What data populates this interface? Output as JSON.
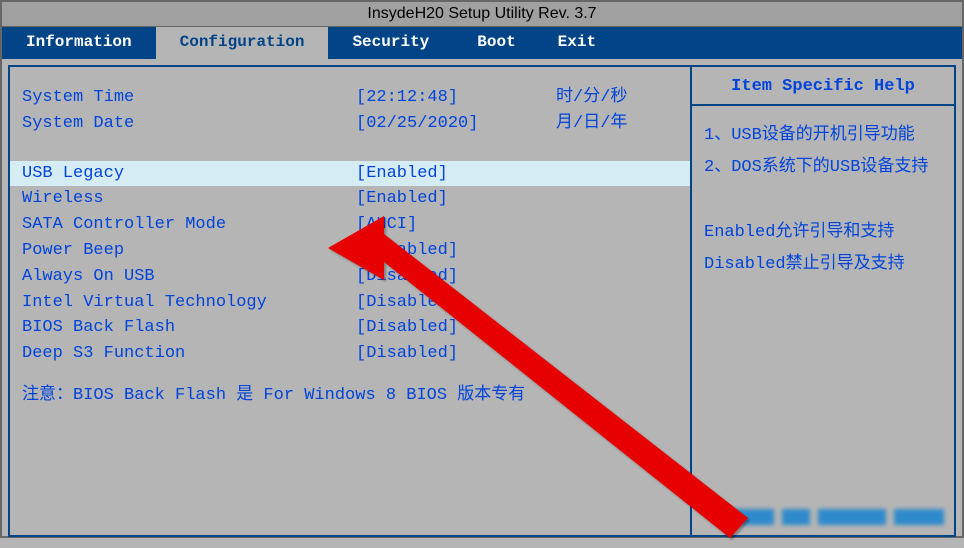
{
  "window": {
    "title": "InsydeH20 Setup Utility Rev. 3.7"
  },
  "tabs": {
    "information": "Information",
    "configuration": "Configuration",
    "security": "Security",
    "boot": "Boot",
    "exit": "Exit"
  },
  "settings": {
    "system_time": {
      "label": "System Time",
      "value": "[22:12:48]",
      "hint": "时/分/秒"
    },
    "system_date": {
      "label": "System Date",
      "value": "[02/25/2020]",
      "hint": "月/日/年"
    },
    "usb_legacy": {
      "label": "USB Legacy",
      "value": "[Enabled]"
    },
    "wireless": {
      "label": "Wireless",
      "value": "[Enabled]"
    },
    "sata_mode": {
      "label": "SATA Controller Mode",
      "value": "[AHCI]"
    },
    "power_beep": {
      "label": "Power Beep",
      "value": "[Disabled]"
    },
    "always_on_usb": {
      "label": "Always On USB",
      "value": "[Disabled]"
    },
    "intel_vt": {
      "label": "Intel Virtual Technology",
      "value": "[Disabled]"
    },
    "bios_back_flash": {
      "label": "BIOS Back Flash",
      "value": "[Disabled]"
    },
    "deep_s3": {
      "label": "Deep S3 Function",
      "value": "[Disabled]"
    }
  },
  "note": "注意：BIOS Back Flash 是 For Windows 8 BIOS 版本专有",
  "help": {
    "title": "Item Specific Help",
    "item1": "1、USB设备的开机引导功能",
    "item2": "2、DOS系统下的USB设备支持",
    "enabled_text": "Enabled允许引导和支持",
    "disabled_text": "Disabled禁止引导及支持"
  }
}
